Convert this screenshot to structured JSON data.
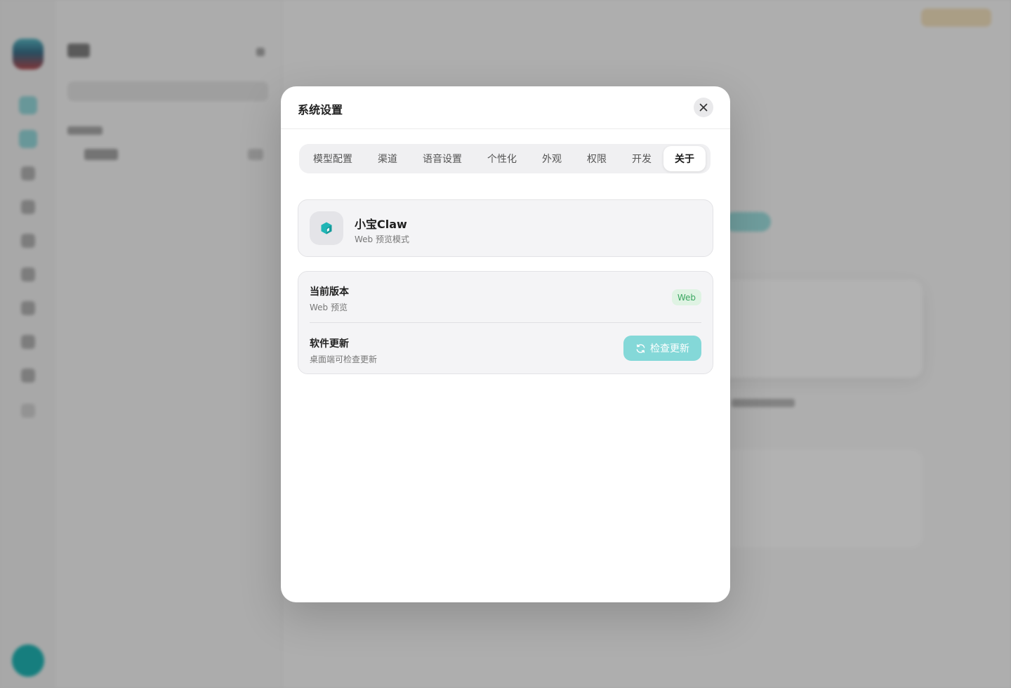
{
  "dialog": {
    "title": "系统设置",
    "close_icon": "close-icon"
  },
  "tabs": [
    {
      "label": "模型配置",
      "active": false
    },
    {
      "label": "渠道",
      "active": false
    },
    {
      "label": "语音设置",
      "active": false
    },
    {
      "label": "个性化",
      "active": false
    },
    {
      "label": "外观",
      "active": false
    },
    {
      "label": "权限",
      "active": false
    },
    {
      "label": "开发",
      "active": false
    },
    {
      "label": "关于",
      "active": true
    }
  ],
  "about": {
    "app_icon": "cube-icon",
    "app_name": "小宝Claw",
    "mode": "Web 预览模式"
  },
  "version": {
    "title": "当前版本",
    "value": "Web 预览",
    "badge": "Web"
  },
  "update": {
    "title": "软件更新",
    "subtitle": "桌面端可检查更新",
    "button_label": "检查更新",
    "button_icon": "refresh-icon"
  },
  "colors": {
    "accent": "#20b5b5",
    "button_bg": "#84d8d8",
    "badge_bg": "#dff3e3",
    "badge_text": "#3aa660"
  }
}
